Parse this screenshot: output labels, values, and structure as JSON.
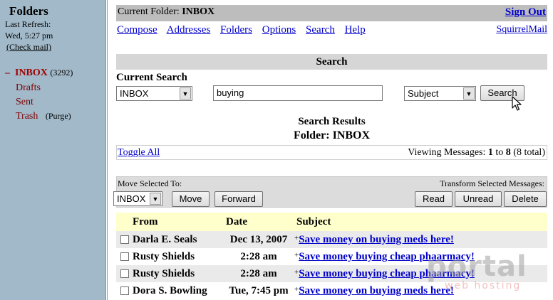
{
  "left_pane": {
    "title": "Folders",
    "last_refresh_label": "Last Refresh:",
    "last_refresh_time": "Wed, 5:27 pm",
    "check_mail": "(Check mail)",
    "folders": [
      {
        "name": "INBOX",
        "marker": "–",
        "count": "(3292)"
      },
      {
        "name": "Drafts"
      },
      {
        "name": "Sent"
      },
      {
        "name": "Trash",
        "extra": "(Purge)"
      }
    ]
  },
  "header": {
    "current_folder_label": "Current Folder:",
    "current_folder": "INBOX",
    "sign_out": "Sign Out",
    "menu": [
      "Compose",
      "Addresses",
      "Folders",
      "Options",
      "Search",
      "Help"
    ],
    "brand_link": "SquirrelMail"
  },
  "search": {
    "section_title": "Search",
    "current_search_label": "Current Search",
    "folder_value": "INBOX",
    "query_value": "buying",
    "field_value": "Subject",
    "search_button": "Search"
  },
  "results": {
    "title": "Search Results",
    "folder_line": "Folder: INBOX",
    "toggle_all": "Toggle All",
    "viewing_prefix": "Viewing Messages:",
    "viewing_from": "1",
    "viewing_to_word": "to",
    "viewing_to": "8",
    "viewing_total": "(8 total)"
  },
  "actions": {
    "move_label": "Move Selected To:",
    "move_folder": "INBOX",
    "move_button": "Move",
    "forward_button": "Forward",
    "transform_label": "Transform Selected Messages:",
    "read_button": "Read",
    "unread_button": "Unread",
    "delete_button": "Delete"
  },
  "table": {
    "columns": [
      "From",
      "Date",
      "Subject"
    ],
    "rows": [
      {
        "from": "Darla E. Seals",
        "date": "Dec 13, 2007",
        "subject": "Save money on buying meds here!"
      },
      {
        "from": "Rusty Shields",
        "date": "2:28 am",
        "subject": "Save money buying cheap phaarmacy!"
      },
      {
        "from": "Rusty Shields",
        "date": "2:28 am",
        "subject": "Save money buying cheap phaarmacy!"
      },
      {
        "from": "Dora S. Bowling",
        "date": "Tue, 7:45 pm",
        "subject": "Save money on buying meds here!"
      }
    ],
    "plus_marker": "+"
  },
  "watermark": {
    "line1": "portal",
    "line2": "web hosting"
  }
}
